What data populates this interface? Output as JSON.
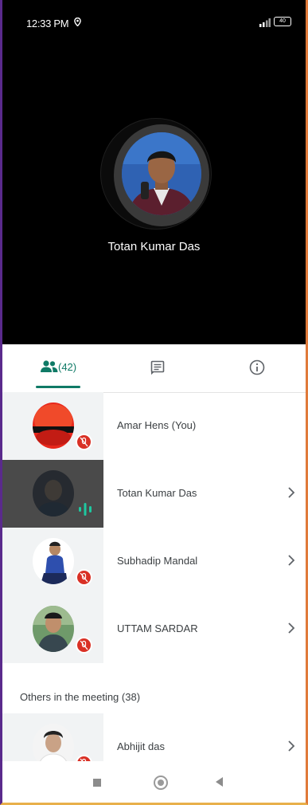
{
  "status_bar": {
    "time": "12:33 PM",
    "battery": "40"
  },
  "active_speaker": {
    "name": "Totan Kumar Das"
  },
  "tabs": {
    "people_count": "(42)"
  },
  "participants": [
    {
      "name": "Amar Hens (You)",
      "status": "muted"
    },
    {
      "name": "Totan Kumar Das",
      "status": "speaking"
    },
    {
      "name": "Subhadip Mandal",
      "status": "muted"
    },
    {
      "name": "UTTAM SARDAR",
      "status": "muted"
    }
  ],
  "others_section": {
    "title": "Others in the meeting (38)"
  },
  "others": [
    {
      "name": "Abhijit das",
      "status": "muted"
    }
  ],
  "colors": {
    "accent": "#0f7a66",
    "mute": "#d93025",
    "speaking": "#1ec8a0"
  }
}
